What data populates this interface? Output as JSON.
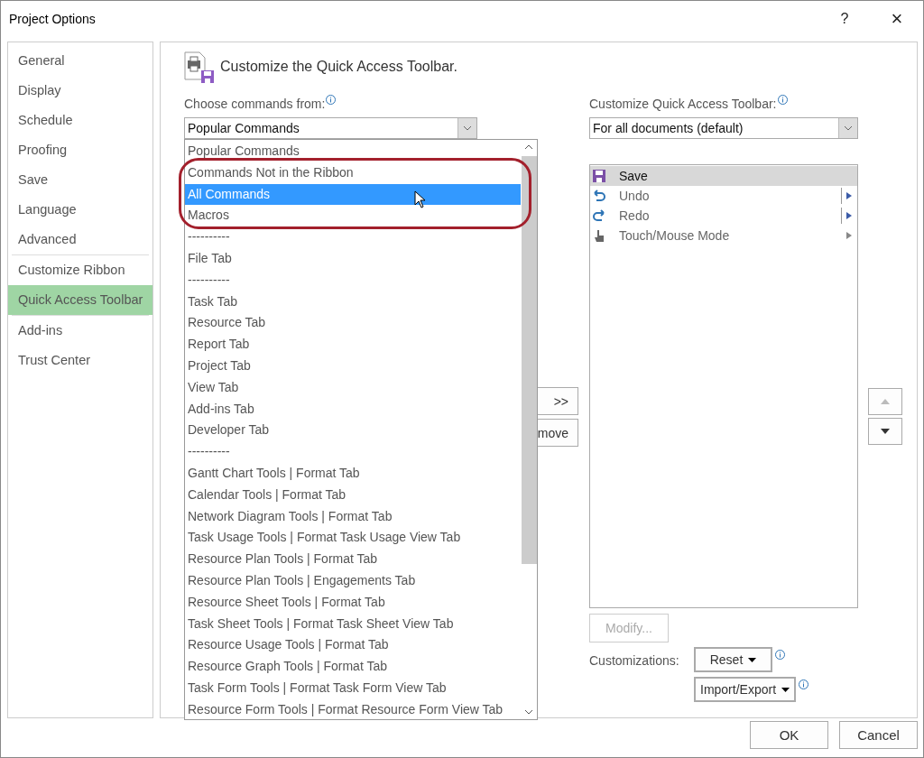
{
  "window": {
    "title": "Project Options",
    "help": "?",
    "close": "×"
  },
  "sidebar": {
    "groups": [
      [
        {
          "label": "General",
          "selected": false
        },
        {
          "label": "Display",
          "selected": false
        },
        {
          "label": "Schedule",
          "selected": false
        },
        {
          "label": "Proofing",
          "selected": false
        },
        {
          "label": "Save",
          "selected": false
        },
        {
          "label": "Language",
          "selected": false
        },
        {
          "label": "Advanced",
          "selected": false
        }
      ],
      [
        {
          "label": "Customize Ribbon",
          "selected": false
        },
        {
          "label": "Quick Access Toolbar",
          "selected": true
        }
      ],
      [
        {
          "label": "Add-ins",
          "selected": false
        },
        {
          "label": "Trust Center",
          "selected": false
        }
      ]
    ]
  },
  "heading": "Customize the Quick Access Toolbar.",
  "commands_from": {
    "label": "Choose commands from:",
    "value": "Popular Commands",
    "options": [
      {
        "label": "Popular Commands",
        "highlighted": false
      },
      {
        "label": "Commands Not in the Ribbon",
        "highlighted": false
      },
      {
        "label": "All Commands",
        "highlighted": true
      },
      {
        "label": "Macros",
        "highlighted": false
      },
      {
        "label": "----------",
        "highlighted": false
      },
      {
        "label": "File Tab",
        "highlighted": false
      },
      {
        "label": "----------",
        "highlighted": false
      },
      {
        "label": "Task Tab",
        "highlighted": false
      },
      {
        "label": "Resource Tab",
        "highlighted": false
      },
      {
        "label": "Report Tab",
        "highlighted": false
      },
      {
        "label": "Project Tab",
        "highlighted": false
      },
      {
        "label": "View Tab",
        "highlighted": false
      },
      {
        "label": "Add-ins Tab",
        "highlighted": false
      },
      {
        "label": "Developer Tab",
        "highlighted": false
      },
      {
        "label": "----------",
        "highlighted": false
      },
      {
        "label": "Gantt Chart Tools | Format Tab",
        "highlighted": false
      },
      {
        "label": "Calendar Tools | Format Tab",
        "highlighted": false
      },
      {
        "label": "Network Diagram Tools | Format Tab",
        "highlighted": false
      },
      {
        "label": "Task Usage Tools | Format Task Usage View Tab",
        "highlighted": false
      },
      {
        "label": "Resource Plan Tools | Format Tab",
        "highlighted": false
      },
      {
        "label": "Resource Plan Tools | Engagements Tab",
        "highlighted": false
      },
      {
        "label": "Resource Sheet Tools | Format Tab",
        "highlighted": false
      },
      {
        "label": "Task Sheet Tools | Format Task Sheet View Tab",
        "highlighted": false
      },
      {
        "label": "Resource Usage Tools | Format Tab",
        "highlighted": false
      },
      {
        "label": "Resource Graph Tools | Format Tab",
        "highlighted": false
      },
      {
        "label": "Task Form Tools | Format Task Form View Tab",
        "highlighted": false
      },
      {
        "label": "Resource Form Tools | Format Resource Form View Tab",
        "highlighted": false
      }
    ]
  },
  "add_button": ">>",
  "remove_button": "move",
  "toolbar_for": {
    "label": "Customize Quick Access Toolbar:",
    "value": "For all documents (default)"
  },
  "toolbar_items": [
    {
      "kind": "save",
      "label": "Save",
      "selected": true,
      "split": false,
      "submenu": false
    },
    {
      "kind": "undo",
      "label": "Undo",
      "selected": false,
      "split": true,
      "submenu": true
    },
    {
      "kind": "redo",
      "label": "Redo",
      "selected": false,
      "split": true,
      "submenu": true
    },
    {
      "kind": "touch",
      "label": "Touch/Mouse Mode",
      "selected": false,
      "split": false,
      "submenu": true
    }
  ],
  "modify_button": {
    "label": "Modify...",
    "disabled": true
  },
  "customizations_label": "Customizations:",
  "reset_button": "Reset",
  "import_export_button": "Import/Export",
  "buttons": [
    "OK",
    "Cancel"
  ]
}
